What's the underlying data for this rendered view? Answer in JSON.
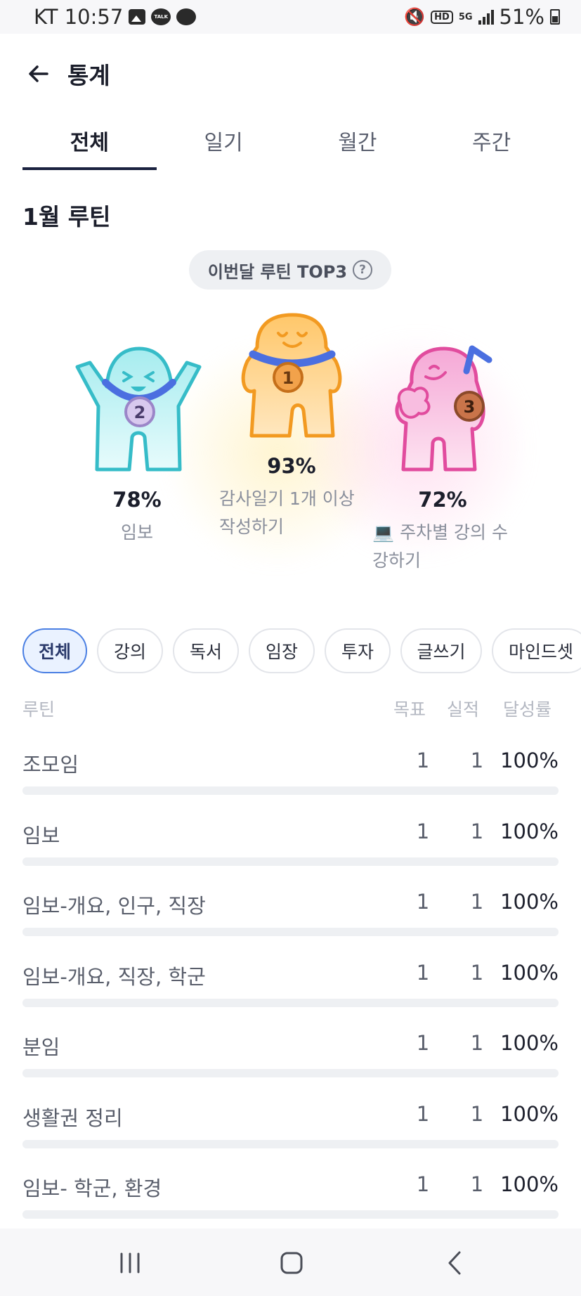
{
  "status_bar": {
    "carrier_time": "KT 10:57",
    "icons_left": [
      "gallery-icon",
      "kakaotalk-icon",
      "chat-bubble-icon"
    ],
    "talk_label": "TALK",
    "hd_label": "HD",
    "network_label": "5G",
    "battery": "51%"
  },
  "header": {
    "title": "통계",
    "back_icon": "arrow-left-icon"
  },
  "tabs": [
    {
      "label": "전체",
      "active": true
    },
    {
      "label": "일기",
      "active": false
    },
    {
      "label": "월간",
      "active": false
    },
    {
      "label": "주간",
      "active": false
    }
  ],
  "section": {
    "title": "1월 루틴",
    "top3_label": "이번달 루틴 TOP3",
    "help_icon": "question-circle-icon"
  },
  "podium": [
    {
      "rank": "2",
      "percent": "78%",
      "name": "임보",
      "color": "#3fc6d3",
      "medal": "silver"
    },
    {
      "rank": "1",
      "percent": "93%",
      "name_line1": "감사일기 1개 이상",
      "name_line2": "작성하기",
      "color": "#f5a623",
      "medal": "gold"
    },
    {
      "rank": "3",
      "percent": "72%",
      "name_line1": "💻 주차별 강의 수",
      "name_line2": "강하기",
      "color": "#e96fb7",
      "medal": "bronze"
    }
  ],
  "chips": [
    {
      "label": "전체",
      "active": true
    },
    {
      "label": "강의",
      "active": false
    },
    {
      "label": "독서",
      "active": false
    },
    {
      "label": "임장",
      "active": false
    },
    {
      "label": "투자",
      "active": false
    },
    {
      "label": "글쓰기",
      "active": false
    },
    {
      "label": "마인드셋",
      "active": false
    }
  ],
  "table": {
    "col_routine": "루틴",
    "col_goal": "목표",
    "col_actual": "실적",
    "col_rate": "달성률",
    "rows": [
      {
        "name": "조모임",
        "goal": "1",
        "actual": "1",
        "rate": "100%",
        "progress": 1.0
      },
      {
        "name": "임보",
        "goal": "1",
        "actual": "1",
        "rate": "100%",
        "progress": 1.0
      },
      {
        "name": "임보-개요, 인구, 직장",
        "goal": "1",
        "actual": "1",
        "rate": "100%",
        "progress": 1.0
      },
      {
        "name": "임보-개요, 직장, 학군",
        "goal": "1",
        "actual": "1",
        "rate": "100%",
        "progress": 1.0
      },
      {
        "name": "분임",
        "goal": "1",
        "actual": "1",
        "rate": "100%",
        "progress": 1.0
      },
      {
        "name": "생활권 정리",
        "goal": "1",
        "actual": "1",
        "rate": "100%",
        "progress": 1.0
      },
      {
        "name": "임보- 학군, 환경",
        "goal": "1",
        "actual": "1",
        "rate": "100%",
        "progress": 1.0
      }
    ]
  },
  "navbar": {
    "recents_icon": "recents-icon",
    "home_icon": "home-icon",
    "back_icon": "back-chevron-icon"
  }
}
